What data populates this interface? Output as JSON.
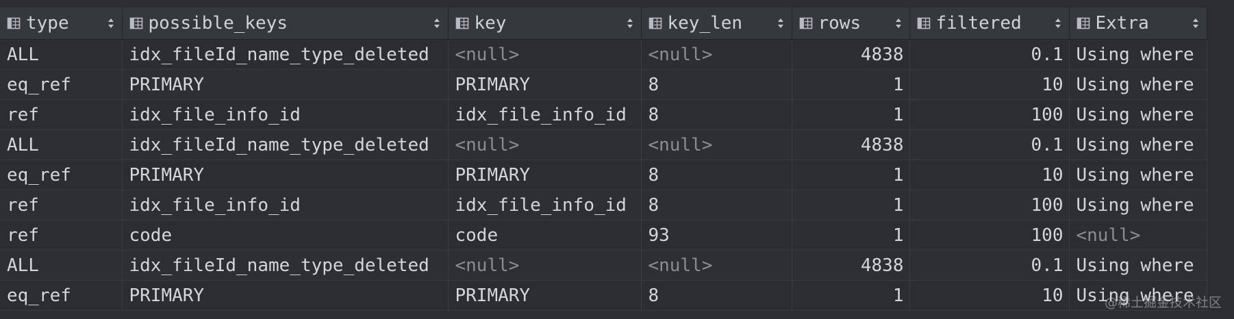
{
  "columns": [
    {
      "key": "type",
      "label": "type"
    },
    {
      "key": "possible_keys",
      "label": "possible_keys"
    },
    {
      "key": "key",
      "label": "key"
    },
    {
      "key": "key_len",
      "label": "key_len"
    },
    {
      "key": "rows",
      "label": "rows"
    },
    {
      "key": "filtered",
      "label": "filtered"
    },
    {
      "key": "extra",
      "label": "Extra"
    }
  ],
  "rows": [
    {
      "type": "ALL",
      "possible_keys": "idx_fileId_name_type_deleted",
      "key": "<null>",
      "key_len": "<null>",
      "rows": "4838",
      "filtered": "0.1",
      "extra": "Using where"
    },
    {
      "type": "eq_ref",
      "possible_keys": "PRIMARY",
      "key": "PRIMARY",
      "key_len": "8",
      "rows": "1",
      "filtered": "10",
      "extra": "Using where"
    },
    {
      "type": "ref",
      "possible_keys": "idx_file_info_id",
      "key": "idx_file_info_id",
      "key_len": "8",
      "rows": "1",
      "filtered": "100",
      "extra": "Using where"
    },
    {
      "type": "ALL",
      "possible_keys": "idx_fileId_name_type_deleted",
      "key": "<null>",
      "key_len": "<null>",
      "rows": "4838",
      "filtered": "0.1",
      "extra": "Using where"
    },
    {
      "type": "eq_ref",
      "possible_keys": "PRIMARY",
      "key": "PRIMARY",
      "key_len": "8",
      "rows": "1",
      "filtered": "10",
      "extra": "Using where"
    },
    {
      "type": "ref",
      "possible_keys": "idx_file_info_id",
      "key": "idx_file_info_id",
      "key_len": "8",
      "rows": "1",
      "filtered": "100",
      "extra": "Using where"
    },
    {
      "type": "ref",
      "possible_keys": "code",
      "key": "code",
      "key_len": "93",
      "rows": "1",
      "filtered": "100",
      "extra": "<null>"
    },
    {
      "type": "ALL",
      "possible_keys": "idx_fileId_name_type_deleted",
      "key": "<null>",
      "key_len": "<null>",
      "rows": "4838",
      "filtered": "0.1",
      "extra": "Using where"
    },
    {
      "type": "eq_ref",
      "possible_keys": "PRIMARY",
      "key": "PRIMARY",
      "key_len": "8",
      "rows": "1",
      "filtered": "10",
      "extra": "Using where"
    }
  ],
  "null_display": "<null>",
  "icons": {
    "column": "table-column-icon",
    "sort": "sort-arrows-icon"
  },
  "watermark": "@稀土掘金技术社区",
  "colors": {
    "background": "#2b2d30",
    "header_background": "#35383c",
    "text": "#d4d6da",
    "null_text": "#8a8d92"
  }
}
